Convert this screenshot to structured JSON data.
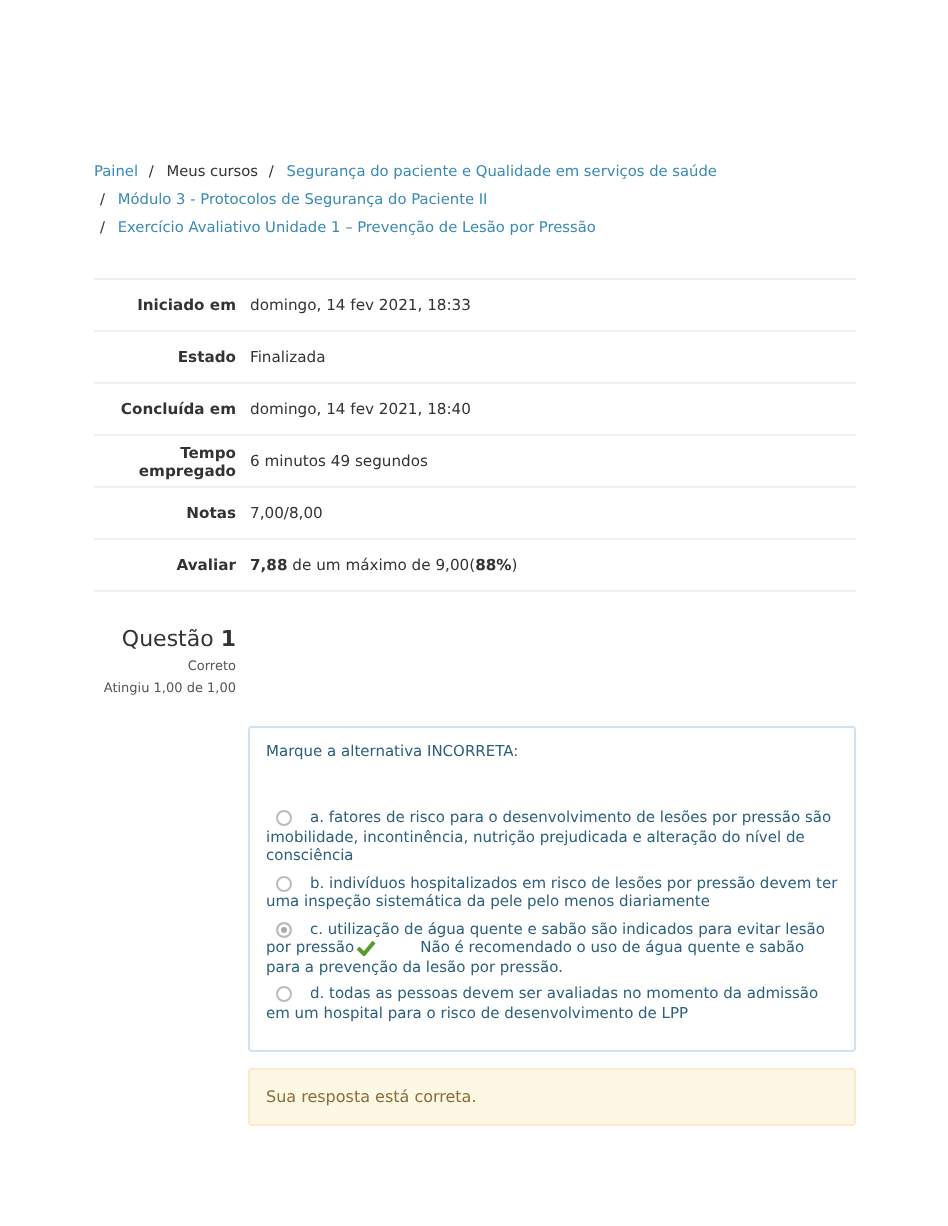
{
  "breadcrumb": [
    {
      "label": "Painel",
      "link": true
    },
    {
      "separator": "/",
      "label": "Meus cursos",
      "link": false
    },
    {
      "separator": "/",
      "label": "Segurança do paciente e Qualidade em serviços de saúde",
      "link": true
    },
    {
      "separator": "/",
      "label": "Módulo 3 - Protocolos de Segurança do Paciente II",
      "link": true
    },
    {
      "separator": "/",
      "label": "Exercício Avaliativo Unidade 1 – Prevenção de Lesão por Pressão",
      "link": true
    }
  ],
  "summary": [
    {
      "label": "Iniciado em",
      "value": "domingo, 14 fev 2021, 18:33"
    },
    {
      "label": "Estado",
      "value": "Finalizada"
    },
    {
      "label": "Concluída em",
      "value": "domingo, 14 fev 2021, 18:40"
    },
    {
      "label": "Tempo empregado",
      "value": "6 minutos 49 segundos"
    },
    {
      "label": "Notas",
      "value": "7,00/8,00"
    },
    {
      "label": "Avaliar",
      "value": "**7,88** de um máximo de 9,00(**88%**)"
    }
  ],
  "question": {
    "title": "Questão **1**",
    "status": "Correto",
    "score": "Atingiu 1,00 de 1,00",
    "prompt": "Marque a alternativa INCORRETA:",
    "options": [
      {
        "text": "a. fatores de risco para o desenvolvimento de lesões por pressão são imobilidade, incontinência, nutrição prejudicada e alteração do nível de consciência",
        "selected": false,
        "correct": false
      },
      {
        "text": "b. indivíduos hospitalizados em risco de lesões por pressão devem ter uma inspeção sistemática da pele pelo menos diariamente",
        "selected": false,
        "correct": false
      },
      {
        "text": "c. utilização de água quente e sabão são indicados para evitar lesão por pressão",
        "selected": true,
        "correct": true,
        "feedback": "Não é recomendado o uso de água quente e sabão para a prevenção da lesão por pressão."
      },
      {
        "text": "d. todas as pessoas devem ser avaliadas no momento da admissão em um hospital para o risco de desenvolvimento de LPP",
        "selected": false,
        "correct": false
      }
    ],
    "feedback": "Sua resposta está correta."
  }
}
